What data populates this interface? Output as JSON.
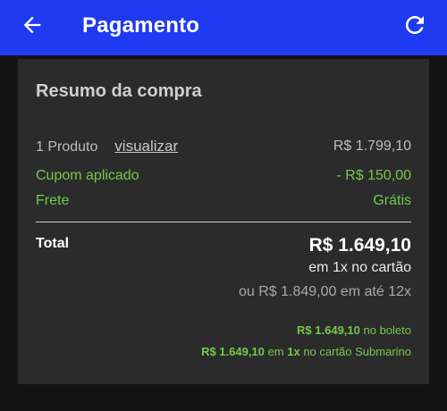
{
  "header": {
    "title": "Pagamento",
    "back_icon": "arrow-left-icon",
    "refresh_icon": "refresh-icon",
    "background_color": "#1f3af0"
  },
  "summary": {
    "title": "Resumo da compra",
    "products_label": "1 Produto",
    "view_link": "visualizar",
    "products_value": "R$ 1.799,10",
    "coupon_label": "Cupom aplicado",
    "coupon_value": "- R$ 150,00",
    "shipping_label": "Frete",
    "shipping_value": "Grátis",
    "total_label": "Total",
    "total_value": "R$ 1.649,10",
    "total_payment": "em 1x no cartão",
    "installments": "ou R$ 1.849,00 em até 12x",
    "boleto_price": "R$ 1.649,10",
    "boleto_text": "no boleto",
    "card_price": "R$ 1.649,10",
    "card_em": "em",
    "card_times": "1x",
    "card_text": "no cartão Submarino",
    "accent_green": "#74c94a"
  }
}
